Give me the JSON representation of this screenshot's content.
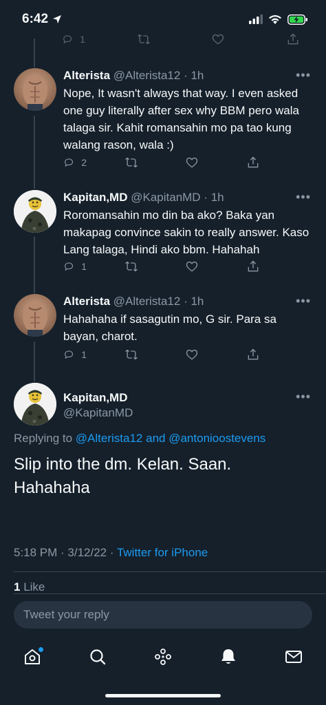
{
  "status": {
    "time": "6:42"
  },
  "top_actions": {
    "reply_count": "1"
  },
  "tweets": [
    {
      "name": "Alterista",
      "handle": "@Alterista12",
      "time": "· 1h",
      "text": "Nope, It wasn't always that way. I even asked one guy literally after sex why BBM pero wala talaga sir. Kahit romansahin mo pa tao kung walang rason, wala :)",
      "reply_count": "2"
    },
    {
      "name": "Kapitan,MD",
      "handle": "@KapitanMD",
      "time": "· 1h",
      "text": "Roromansahin mo din ba ako? Baka yan makapag convince sakin to really answer. Kaso Lang talaga, Hindi ako bbm. Hahahah",
      "reply_count": "1"
    },
    {
      "name": "Alterista",
      "handle": "@Alterista12",
      "time": "· 1h",
      "text": "Hahahaha if sasagutin mo, G sir. Para sa bayan, charot.",
      "reply_count": "1"
    }
  ],
  "main_tweet": {
    "name": "Kapitan,MD",
    "handle": "@KapitanMD",
    "replying_prefix": "Replying to",
    "replying_user1": "@Alterista12",
    "replying_and": "and",
    "replying_user2": "@antonioostevens",
    "text_line1": "Slip into the dm. Kelan. Saan.",
    "text_line2": "Hahahaha",
    "timestamp": "5:18 PM · 3/12/22 ·",
    "source": "Twitter for iPhone",
    "like_count": "1",
    "like_label": "Like"
  },
  "reply_box": {
    "placeholder": "Tweet your reply"
  },
  "more_glyph": "•••",
  "colors": {
    "background": "#15202b",
    "accent": "#1d9bf0",
    "secondary_text": "#8b98a5"
  }
}
